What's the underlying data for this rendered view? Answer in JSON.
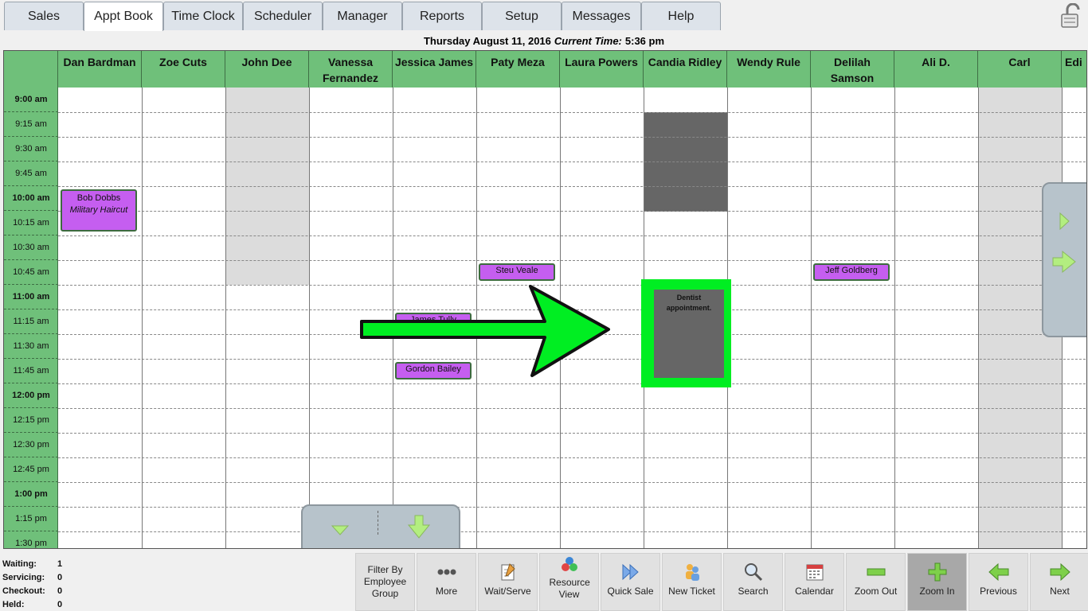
{
  "tabs": [
    "Sales",
    "Appt Book",
    "Time Clock",
    "Scheduler",
    "Manager",
    "Reports",
    "Setup",
    "Messages",
    "Help"
  ],
  "active_tab": "Appt Book",
  "date": {
    "text": "Thursday August 11, 2016",
    "current_label": "Current Time:",
    "current_time": "5:36 pm"
  },
  "employees": [
    "Dan Bardman",
    "Zoe Cuts",
    "John Dee",
    "Vanessa Fernandez",
    "Jessica James",
    "Paty Meza",
    "Laura Powers",
    "Candia Ridley",
    "Wendy Rule",
    "Delilah Samson",
    "Ali D.",
    "Carl",
    "Edi"
  ],
  "times": [
    "9:00 am",
    "9:15 am",
    "9:30 am",
    "9:45 am",
    "10:00 am",
    "10:15 am",
    "10:30 am",
    "10:45 am",
    "11:00 am",
    "11:15 am",
    "11:30 am",
    "11:45 am",
    "12:00 pm",
    "12:15 pm",
    "12:30 pm",
    "12:45 pm",
    "1:00 pm",
    "1:15 pm",
    "1:30 pm"
  ],
  "appointments": {
    "bob": {
      "client": "Bob Dobbs",
      "service": "Military Haircut"
    },
    "steu": {
      "client": "Steu Veale"
    },
    "jeff": {
      "client": "Jeff Goldberg"
    },
    "james": {
      "client": "James Tully"
    },
    "gordon": {
      "client": "Gordon Bailey"
    },
    "dentist": {
      "text": "Dentist appointment."
    }
  },
  "status": {
    "waiting_label": "Waiting:",
    "waiting": "1",
    "servicing_label": "Servicing:",
    "servicing": "0",
    "checkout_label": "Checkout:",
    "checkout": "0",
    "held_label": "Held:",
    "held": "0"
  },
  "toolbar": {
    "filter": "Filter By Employee Group",
    "more": "More",
    "wait_serve": "Wait/Serve",
    "resource_view": "Resource View",
    "quick_sale": "Quick Sale",
    "new_ticket": "New Ticket",
    "search": "Search",
    "calendar": "Calendar",
    "zoom_out": "Zoom Out",
    "zoom_in": "Zoom In",
    "previous": "Previous",
    "next": "Next"
  },
  "colors": {
    "header_green": "#6fc07a",
    "appointment_purple": "#c55ef0",
    "highlight_green": "#00ee22",
    "busy_gray": "#666666"
  },
  "icons": [
    "lock-icon",
    "more-dots-icon",
    "wait-serve-icon",
    "resource-view-icon",
    "quick-sale-icon",
    "new-ticket-icon",
    "search-icon",
    "calendar-icon",
    "zoom-out-icon",
    "zoom-in-icon",
    "previous-arrow-icon",
    "next-arrow-icon"
  ]
}
